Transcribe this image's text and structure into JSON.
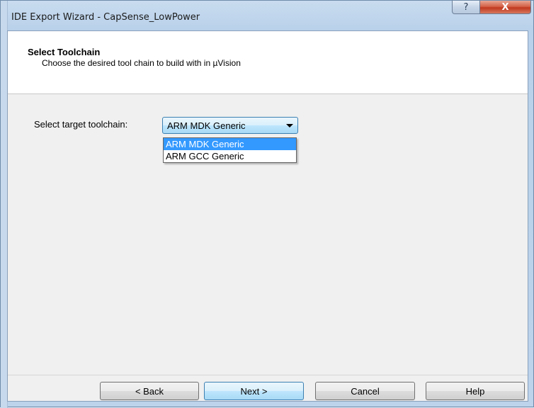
{
  "window": {
    "title": "IDE Export Wizard - CapSense_LowPower",
    "help_glyph": "?",
    "close_glyph": "X"
  },
  "header": {
    "title": "Select Toolchain",
    "subtitle": "Choose the desired tool chain to build with in µVision"
  },
  "toolchain": {
    "label": "Select target toolchain:",
    "selected": "ARM MDK Generic",
    "options": [
      "ARM MDK Generic",
      "ARM GCC Generic"
    ]
  },
  "buttons": {
    "back": "< Back",
    "next": "Next >",
    "cancel": "Cancel",
    "help": "Help"
  },
  "colors": {
    "selection": "#3399ff",
    "close_button": "#c1391f"
  }
}
